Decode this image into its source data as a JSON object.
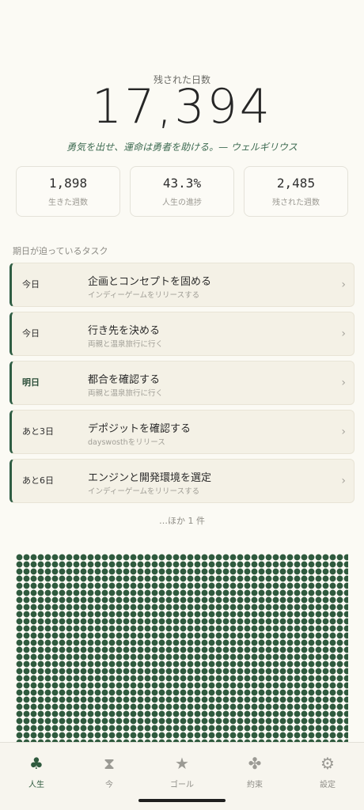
{
  "header": {
    "remaining_label": "残された日数",
    "remaining_days": "17,394",
    "quote": "勇気を出せ、運命は勇者を助ける。— ウェルギリウス"
  },
  "stats": [
    {
      "value": "1,898",
      "label": "生きた週数"
    },
    {
      "value": "43.3%",
      "label": "人生の進捗"
    },
    {
      "value": "2,485",
      "label": "残された週数"
    }
  ],
  "tasks_section": {
    "title": "期日が迫っているタスク",
    "items": [
      {
        "when": "今日",
        "title": "企画とコンセプトを固める",
        "subtitle": "インディーゲームをリリースする"
      },
      {
        "when": "今日",
        "title": "行き先を決める",
        "subtitle": "両親と温泉旅行に行く"
      },
      {
        "when": "明日",
        "title": "都合を確認する",
        "subtitle": "両親と温泉旅行に行く"
      },
      {
        "when": "あと3日",
        "title": "デポジットを確認する",
        "subtitle": "dayswosthをリリース"
      },
      {
        "when": "あと6日",
        "title": "エンジンと開発環境を選定",
        "subtitle": "インディーゲームをリリースする"
      }
    ],
    "more": "…ほか 1 件"
  },
  "life_grid": {
    "lived_color": "#2f5a3e"
  },
  "tabbar": {
    "tabs": [
      {
        "label": "人生",
        "icon": "club-icon",
        "active": true
      },
      {
        "label": "今",
        "icon": "hourglass-icon",
        "active": false
      },
      {
        "label": "ゴール",
        "icon": "star-icon",
        "active": false
      },
      {
        "label": "約束",
        "icon": "clover-icon",
        "active": false
      },
      {
        "label": "設定",
        "icon": "gear-icon",
        "active": false
      }
    ]
  },
  "colors": {
    "accent": "#2f5a3e",
    "background": "#fbfaf4"
  }
}
